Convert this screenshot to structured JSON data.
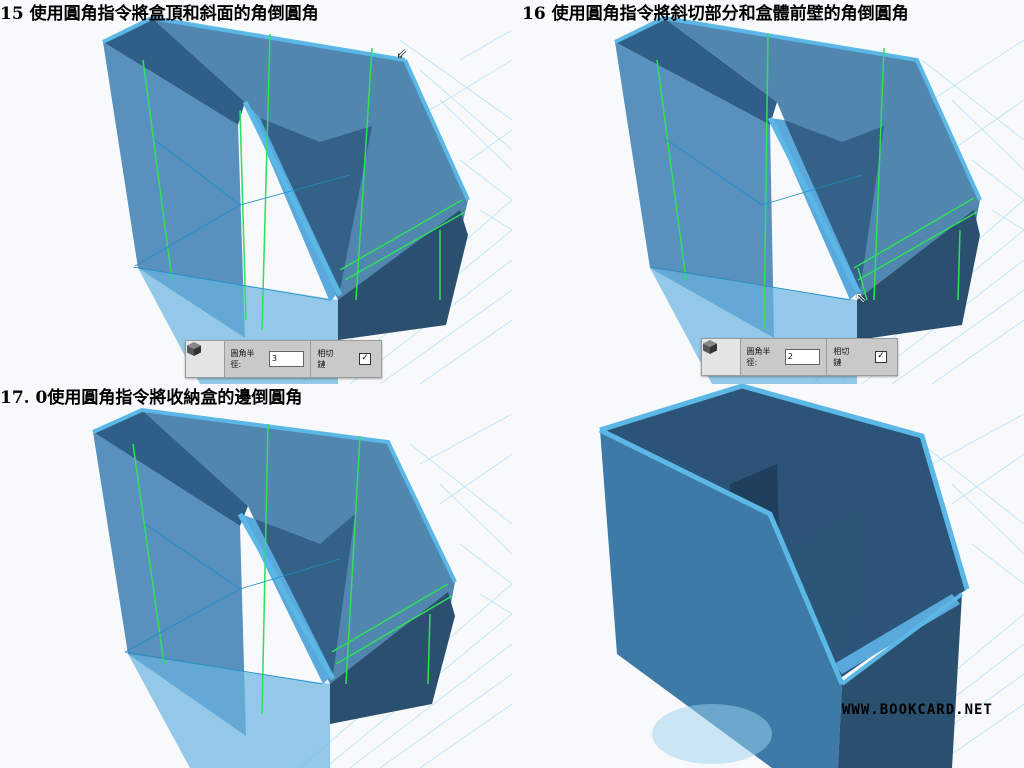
{
  "steps": [
    {
      "caption": "15 使用圓角指令將盒頂和斜面的角倒圓角",
      "toolbar": {
        "radius_label": "圓角半徑:",
        "radius_value": "3",
        "tangent_label": "相切鏈",
        "tangent_checked": "✓"
      }
    },
    {
      "caption": "16 使用圓角指令將斜切部分和盒體前壁的角倒圓角",
      "toolbar": {
        "radius_label": "圓角半徑:",
        "radius_value": "2",
        "tangent_label": "相切鏈",
        "tangent_checked": "✓"
      }
    },
    {
      "caption": "17. 0使用圓角指令將收納盒的邊倒圓角"
    },
    {
      "caption": ""
    }
  ],
  "watermark": "WWW.BOOKCARD.NET",
  "icons": {
    "fillet_tool": "fillet-cube-icon",
    "cursor": "arrow-cursor-icon"
  },
  "colors": {
    "body": "#3f7fae",
    "body_dark": "#24506f",
    "edge": "#5ab7e6",
    "highlight": "#2fe05a",
    "grid": "#7fd0ef"
  }
}
